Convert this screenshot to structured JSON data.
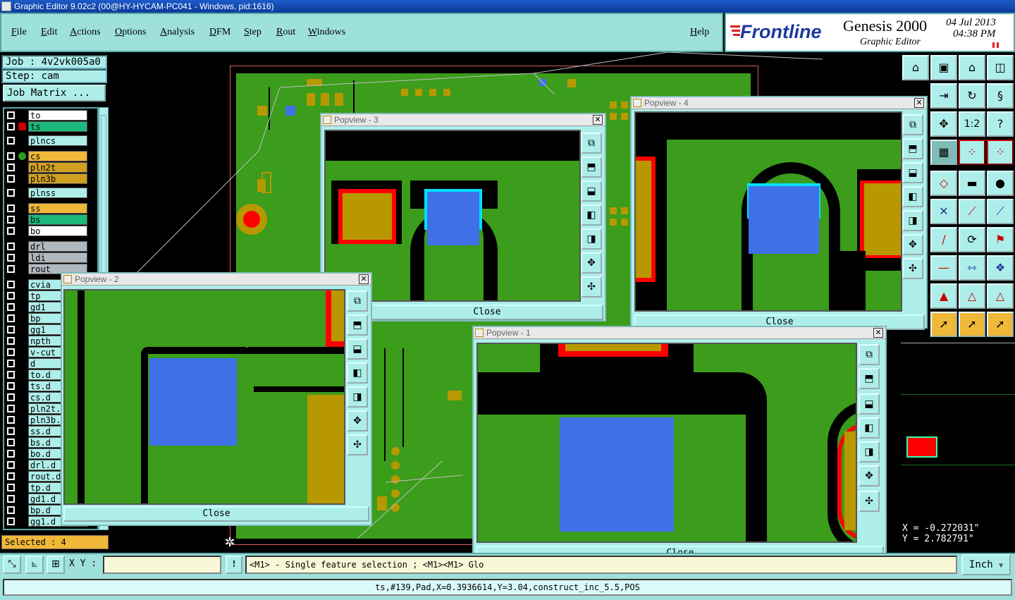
{
  "window_title": "Graphic Editor 9.02c2 (00@HY-HYCAM-PC041 - Windows, pid:1616)",
  "menu": {
    "items": [
      "File",
      "Edit",
      "Actions",
      "Options",
      "Analysis",
      "DFM",
      "Step",
      "Rout",
      "Windows"
    ],
    "help": "Help"
  },
  "logo": {
    "brand": "Frontline",
    "product": "Genesis 2000",
    "subtitle": "Graphic Editor",
    "date": "04 Jul 2013",
    "time": "04:38 PM"
  },
  "job": {
    "job_label": "Job : 4v2vk005a0",
    "step_label": "Step: cam",
    "matrix_button": "Job Matrix ..."
  },
  "layers": [
    "to",
    "ts",
    "plncs",
    "cs",
    "pln2t",
    "pln3b",
    "plnss",
    "ss",
    "bs",
    "bo",
    "drl",
    "ldi",
    "rout",
    "cvia",
    "tp",
    "gd1",
    "bp",
    "gg1",
    "npth",
    "v-cut",
    "d",
    "to.d",
    "ts.d",
    "cs.d",
    "pln2t.",
    "pln3b.",
    "ss.d",
    "bs.d",
    "bo.d",
    "drl.d",
    "rout.d",
    "tp.d",
    "gd1.d",
    "bp.d",
    "gg1.d"
  ],
  "selected_label": "Selected : 4",
  "popups": {
    "p1": {
      "title": "Popview - 1",
      "close": "Close"
    },
    "p2": {
      "title": "Popview - 2",
      "close": "Close"
    },
    "p3": {
      "title": "Popview - 3",
      "close": "Close"
    },
    "p4": {
      "title": "Popview - 4",
      "close": "Close"
    }
  },
  "coords": {
    "x": "X = -0.272031\"",
    "y": "Y = 2.782791\""
  },
  "status": {
    "xy_label": "X Y :",
    "xy_value": "",
    "hint": "<M1> - Single feature selection ; <M1><M1> Glo",
    "units": "Inch",
    "feature_info": "ts,#139,Pad,X=0.3936614,Y=3.04,construct_inc_5.5,POS"
  },
  "colors": {
    "copper": "#3c9c1c",
    "pad": "#b89800",
    "selected_pad": "#4070e8",
    "panel": "#aeeeea"
  }
}
